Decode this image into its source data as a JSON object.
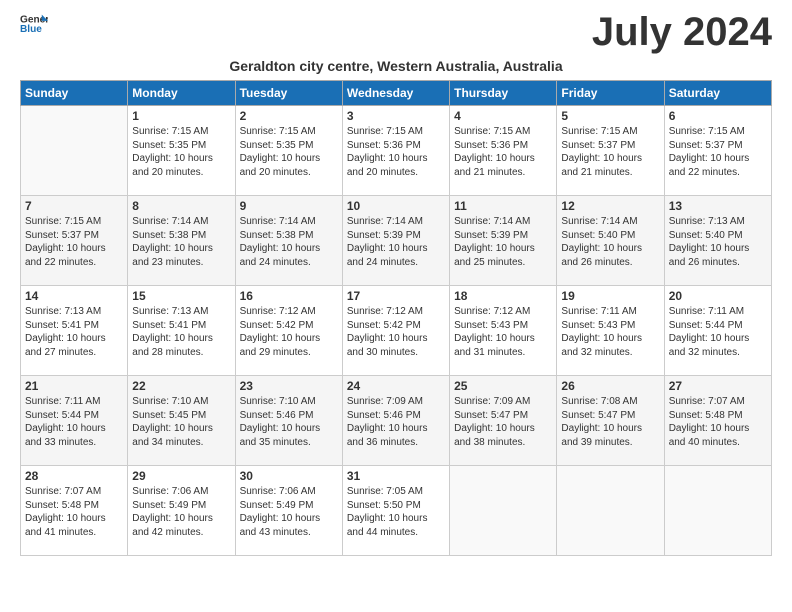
{
  "logo": {
    "general": "General",
    "blue": "Blue"
  },
  "title": "July 2024",
  "subtitle": "Geraldton city centre, Western Australia, Australia",
  "weekdays": [
    "Sunday",
    "Monday",
    "Tuesday",
    "Wednesday",
    "Thursday",
    "Friday",
    "Saturday"
  ],
  "weeks": [
    [
      {
        "day": "",
        "content": ""
      },
      {
        "day": "1",
        "content": "Sunrise: 7:15 AM\nSunset: 5:35 PM\nDaylight: 10 hours\nand 20 minutes."
      },
      {
        "day": "2",
        "content": "Sunrise: 7:15 AM\nSunset: 5:35 PM\nDaylight: 10 hours\nand 20 minutes."
      },
      {
        "day": "3",
        "content": "Sunrise: 7:15 AM\nSunset: 5:36 PM\nDaylight: 10 hours\nand 20 minutes."
      },
      {
        "day": "4",
        "content": "Sunrise: 7:15 AM\nSunset: 5:36 PM\nDaylight: 10 hours\nand 21 minutes."
      },
      {
        "day": "5",
        "content": "Sunrise: 7:15 AM\nSunset: 5:37 PM\nDaylight: 10 hours\nand 21 minutes."
      },
      {
        "day": "6",
        "content": "Sunrise: 7:15 AM\nSunset: 5:37 PM\nDaylight: 10 hours\nand 22 minutes."
      }
    ],
    [
      {
        "day": "7",
        "content": "Sunrise: 7:15 AM\nSunset: 5:37 PM\nDaylight: 10 hours\nand 22 minutes."
      },
      {
        "day": "8",
        "content": "Sunrise: 7:14 AM\nSunset: 5:38 PM\nDaylight: 10 hours\nand 23 minutes."
      },
      {
        "day": "9",
        "content": "Sunrise: 7:14 AM\nSunset: 5:38 PM\nDaylight: 10 hours\nand 24 minutes."
      },
      {
        "day": "10",
        "content": "Sunrise: 7:14 AM\nSunset: 5:39 PM\nDaylight: 10 hours\nand 24 minutes."
      },
      {
        "day": "11",
        "content": "Sunrise: 7:14 AM\nSunset: 5:39 PM\nDaylight: 10 hours\nand 25 minutes."
      },
      {
        "day": "12",
        "content": "Sunrise: 7:14 AM\nSunset: 5:40 PM\nDaylight: 10 hours\nand 26 minutes."
      },
      {
        "day": "13",
        "content": "Sunrise: 7:13 AM\nSunset: 5:40 PM\nDaylight: 10 hours\nand 26 minutes."
      }
    ],
    [
      {
        "day": "14",
        "content": "Sunrise: 7:13 AM\nSunset: 5:41 PM\nDaylight: 10 hours\nand 27 minutes."
      },
      {
        "day": "15",
        "content": "Sunrise: 7:13 AM\nSunset: 5:41 PM\nDaylight: 10 hours\nand 28 minutes."
      },
      {
        "day": "16",
        "content": "Sunrise: 7:12 AM\nSunset: 5:42 PM\nDaylight: 10 hours\nand 29 minutes."
      },
      {
        "day": "17",
        "content": "Sunrise: 7:12 AM\nSunset: 5:42 PM\nDaylight: 10 hours\nand 30 minutes."
      },
      {
        "day": "18",
        "content": "Sunrise: 7:12 AM\nSunset: 5:43 PM\nDaylight: 10 hours\nand 31 minutes."
      },
      {
        "day": "19",
        "content": "Sunrise: 7:11 AM\nSunset: 5:43 PM\nDaylight: 10 hours\nand 32 minutes."
      },
      {
        "day": "20",
        "content": "Sunrise: 7:11 AM\nSunset: 5:44 PM\nDaylight: 10 hours\nand 32 minutes."
      }
    ],
    [
      {
        "day": "21",
        "content": "Sunrise: 7:11 AM\nSunset: 5:44 PM\nDaylight: 10 hours\nand 33 minutes."
      },
      {
        "day": "22",
        "content": "Sunrise: 7:10 AM\nSunset: 5:45 PM\nDaylight: 10 hours\nand 34 minutes."
      },
      {
        "day": "23",
        "content": "Sunrise: 7:10 AM\nSunset: 5:46 PM\nDaylight: 10 hours\nand 35 minutes."
      },
      {
        "day": "24",
        "content": "Sunrise: 7:09 AM\nSunset: 5:46 PM\nDaylight: 10 hours\nand 36 minutes."
      },
      {
        "day": "25",
        "content": "Sunrise: 7:09 AM\nSunset: 5:47 PM\nDaylight: 10 hours\nand 38 minutes."
      },
      {
        "day": "26",
        "content": "Sunrise: 7:08 AM\nSunset: 5:47 PM\nDaylight: 10 hours\nand 39 minutes."
      },
      {
        "day": "27",
        "content": "Sunrise: 7:07 AM\nSunset: 5:48 PM\nDaylight: 10 hours\nand 40 minutes."
      }
    ],
    [
      {
        "day": "28",
        "content": "Sunrise: 7:07 AM\nSunset: 5:48 PM\nDaylight: 10 hours\nand 41 minutes."
      },
      {
        "day": "29",
        "content": "Sunrise: 7:06 AM\nSunset: 5:49 PM\nDaylight: 10 hours\nand 42 minutes."
      },
      {
        "day": "30",
        "content": "Sunrise: 7:06 AM\nSunset: 5:49 PM\nDaylight: 10 hours\nand 43 minutes."
      },
      {
        "day": "31",
        "content": "Sunrise: 7:05 AM\nSunset: 5:50 PM\nDaylight: 10 hours\nand 44 minutes."
      },
      {
        "day": "",
        "content": ""
      },
      {
        "day": "",
        "content": ""
      },
      {
        "day": "",
        "content": ""
      }
    ]
  ]
}
